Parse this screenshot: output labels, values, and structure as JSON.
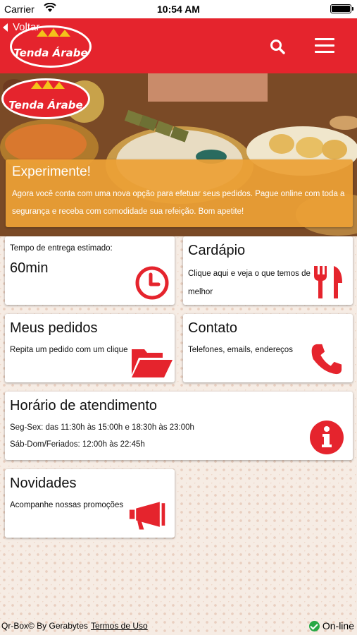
{
  "status_bar": {
    "carrier": "Carrier",
    "time": "10:54 AM"
  },
  "header": {
    "back_label": "Voltar",
    "logo_text": "Tenda Árabe",
    "brand_color": "#e5242d"
  },
  "banner": {
    "logo_text": "Tenda Árabe"
  },
  "promo": {
    "title": "Experimente!",
    "text": "Agora você conta com uma nova opção para efetuar seus pedidos. Pague online com toda a segurança e receba com comodidade sua refeição. Bom apetite!",
    "color": "#eca036"
  },
  "cards": {
    "delivery": {
      "label": "Tempo de entrega estimado:",
      "value": "60min",
      "icon": "clock-icon"
    },
    "menu": {
      "title": "Cardápio",
      "subtitle": "Clique aqui e veja o que temos de melhor",
      "icon": "fork-knife-icon"
    },
    "orders": {
      "title": "Meus pedidos",
      "subtitle": "Repita um pedido com um clique",
      "icon": "folder-open-icon"
    },
    "contact": {
      "title": "Contato",
      "subtitle": "Telefones, emails, endereços",
      "icon": "phone-icon"
    },
    "hours": {
      "title": "Horário de atendimento",
      "line1": "Seg-Sex: das 11:30h às 15:00h e 18:30h às 23:00h",
      "line2": "Sáb-Dom/Feriados: 12:00h às 22:45h",
      "icon": "info-icon"
    },
    "news": {
      "title": "Novidades",
      "subtitle": "Acompanhe nossas promoções",
      "icon": "megaphone-icon"
    }
  },
  "footer": {
    "copyright": "Qr-Box© By Gerabytes",
    "terms": "Termos de Uso",
    "status": "On-line",
    "status_color": "#27a845"
  },
  "accent_color": "#e5242d"
}
